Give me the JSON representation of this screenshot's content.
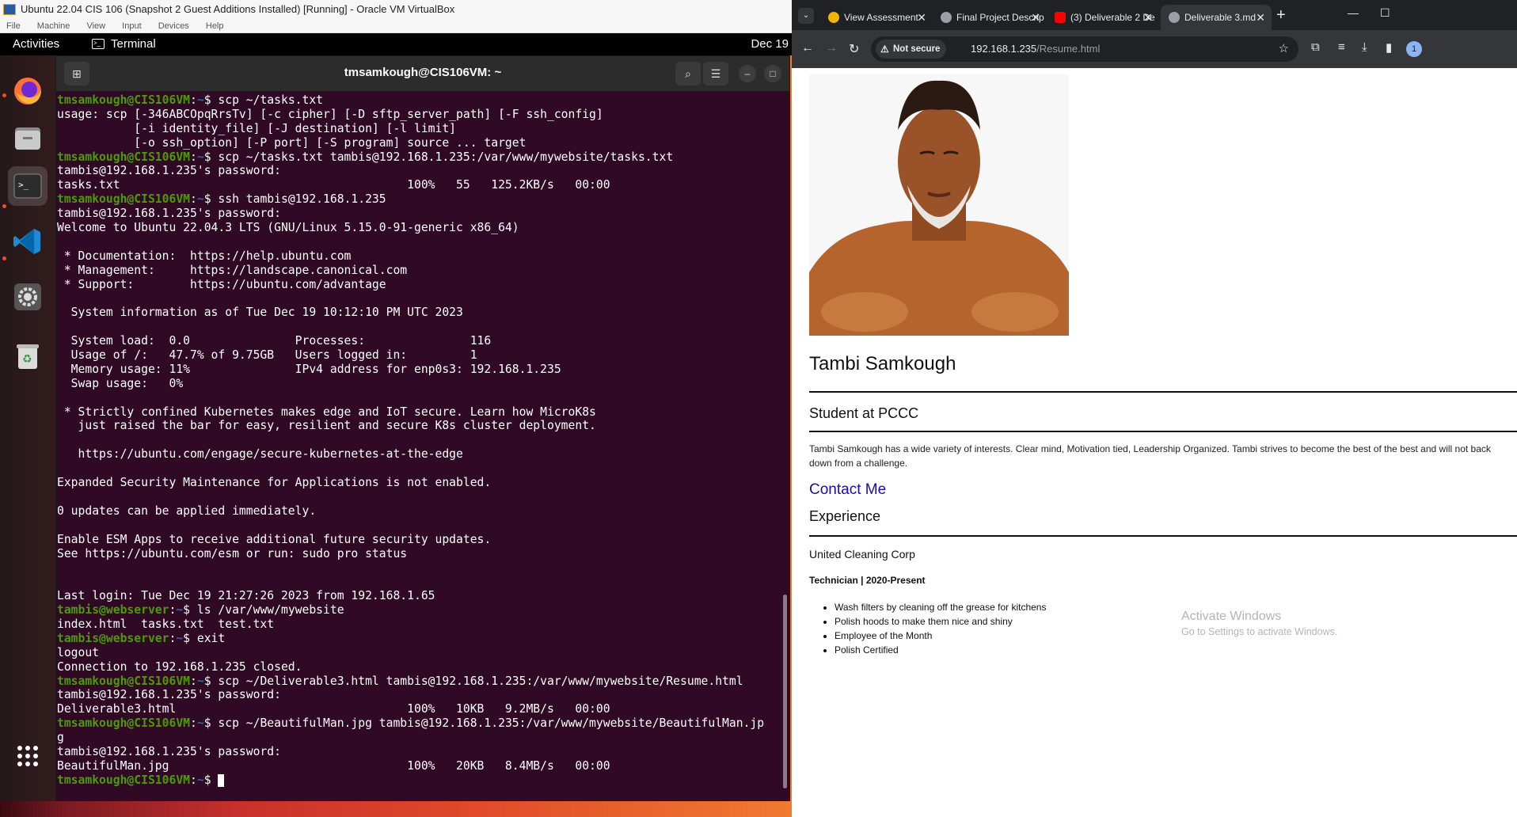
{
  "vbox": {
    "title": "Ubuntu 22.04 CIS 106 (Snapshot 2 Guest Additions Installed) [Running] - Oracle VM VirtualBox",
    "menu": [
      "File",
      "Machine",
      "View",
      "Input",
      "Devices",
      "Help"
    ]
  },
  "gnome": {
    "activities": "Activities",
    "app_name": "Terminal",
    "clock": "Dec 19"
  },
  "dock": [
    "firefox-icon",
    "files-icon",
    "terminal-icon",
    "vscode-icon",
    "settings-icon",
    "trash-icon",
    "app-grid-icon"
  ],
  "terminal": {
    "title": "tmsamkough@CIS106VM: ~",
    "lines": [
      {
        "user": "tmsamkough@CIS106VM",
        "path": "~",
        "cmd": "scp ~/tasks.txt"
      },
      {
        "text": "usage: scp [-346ABCOpqRrsTv] [-c cipher] [-D sftp_server_path] [-F ssh_config]"
      },
      {
        "text": "           [-i identity_file] [-J destination] [-l limit]"
      },
      {
        "text": "           [-o ssh_option] [-P port] [-S program] source ... target"
      },
      {
        "user": "tmsamkough@CIS106VM",
        "path": "~",
        "cmd": "scp ~/tasks.txt tambis@192.168.1.235:/var/www/mywebsite/tasks.txt"
      },
      {
        "text": "tambis@192.168.1.235's password:"
      },
      {
        "text": "tasks.txt                                         100%   55   125.2KB/s   00:00"
      },
      {
        "user": "tmsamkough@CIS106VM",
        "path": "~",
        "cmd": "ssh tambis@192.168.1.235"
      },
      {
        "text": "tambis@192.168.1.235's password:"
      },
      {
        "text": "Welcome to Ubuntu 22.04.3 LTS (GNU/Linux 5.15.0-91-generic x86_64)"
      },
      {
        "text": ""
      },
      {
        "text": " * Documentation:  https://help.ubuntu.com"
      },
      {
        "text": " * Management:     https://landscape.canonical.com"
      },
      {
        "text": " * Support:        https://ubuntu.com/advantage"
      },
      {
        "text": ""
      },
      {
        "text": "  System information as of Tue Dec 19 10:12:10 PM UTC 2023"
      },
      {
        "text": ""
      },
      {
        "text": "  System load:  0.0               Processes:               116"
      },
      {
        "text": "  Usage of /:   47.7% of 9.75GB   Users logged in:         1"
      },
      {
        "text": "  Memory usage: 11%               IPv4 address for enp0s3: 192.168.1.235"
      },
      {
        "text": "  Swap usage:   0%"
      },
      {
        "text": ""
      },
      {
        "text": " * Strictly confined Kubernetes makes edge and IoT secure. Learn how MicroK8s"
      },
      {
        "text": "   just raised the bar for easy, resilient and secure K8s cluster deployment."
      },
      {
        "text": ""
      },
      {
        "text": "   https://ubuntu.com/engage/secure-kubernetes-at-the-edge"
      },
      {
        "text": ""
      },
      {
        "text": "Expanded Security Maintenance for Applications is not enabled."
      },
      {
        "text": ""
      },
      {
        "text": "0 updates can be applied immediately."
      },
      {
        "text": ""
      },
      {
        "text": "Enable ESM Apps to receive additional future security updates."
      },
      {
        "text": "See https://ubuntu.com/esm or run: sudo pro status"
      },
      {
        "text": ""
      },
      {
        "text": ""
      },
      {
        "text": "Last login: Tue Dec 19 21:27:26 2023 from 192.168.1.65"
      },
      {
        "user": "tambis@webserver",
        "path": "~",
        "cmd": "ls /var/www/mywebsite"
      },
      {
        "text": "index.html  tasks.txt  test.txt"
      },
      {
        "user": "tambis@webserver",
        "path": "~",
        "cmd": "exit"
      },
      {
        "text": "logout"
      },
      {
        "text": "Connection to 192.168.1.235 closed."
      },
      {
        "user": "tmsamkough@CIS106VM",
        "path": "~",
        "cmd": "scp ~/Deliverable3.html tambis@192.168.1.235:/var/www/mywebsite/Resume.html"
      },
      {
        "text": "tambis@192.168.1.235's password:"
      },
      {
        "text": "Deliverable3.html                                 100%   10KB   9.2MB/s   00:00"
      },
      {
        "user": "tmsamkough@CIS106VM",
        "path": "~",
        "cmd": "scp ~/BeautifulMan.jpg tambis@192.168.1.235:/var/www/mywebsite/BeautifulMan.jp"
      },
      {
        "text": "g"
      },
      {
        "text": "tambis@192.168.1.235's password:"
      },
      {
        "text": "BeautifulMan.jpg                                  100%   20KB   8.4MB/s   00:00"
      },
      {
        "user": "tmsamkough@CIS106VM",
        "path": "~",
        "cmd": "",
        "cursor": true
      }
    ]
  },
  "chrome": {
    "tabs": [
      {
        "title": "View Assessment",
        "favicon_color": "#f4b400"
      },
      {
        "title": "Final Project Descrip",
        "favicon_color": "#9aa0a6"
      },
      {
        "title": "(3) Deliverable 2 De",
        "favicon_color": "#ff0000"
      },
      {
        "title": "Deliverable 3.md",
        "favicon_color": "#9aa0a6",
        "active": true
      }
    ],
    "not_secure": "Not secure",
    "url_host": "192.168.1.235",
    "url_path": "/Resume.html",
    "profile_badge": "1"
  },
  "resume": {
    "name": "Tambi Samkough",
    "subtitle": "Student at PCCC",
    "bio": "Tambi Samkough has a wide variety of interests. Clear mind, Motivation tied, Leadership Organized. Tambi strives to become the best of the best and will not back down from a challenge.",
    "contact": "Contact Me",
    "experience_heading": "Experience",
    "company": "United Cleaning Corp",
    "role": "Technician | 2020-Present",
    "duties": [
      "Wash filters by cleaning off the grease for kitchens",
      "Polish hoods to make them nice and shiny",
      "Employee of the Month",
      "Polish Certified"
    ]
  },
  "watermark": {
    "title": "Activate Windows",
    "subtitle": "Go to Settings to activate Windows."
  }
}
